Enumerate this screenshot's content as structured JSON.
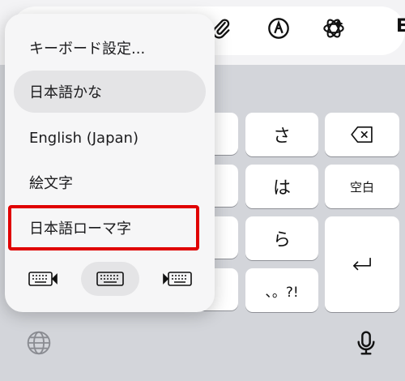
{
  "menu": {
    "items": [
      {
        "label": "キーボード設定..."
      },
      {
        "label": "日本語かな"
      },
      {
        "label": "English (Japan)"
      },
      {
        "label": "絵文字"
      },
      {
        "label": "日本語ローマ字"
      }
    ]
  },
  "keys": {
    "sa": "さ",
    "ha": "は",
    "ra": "ら",
    "punct": "、。?!",
    "space": "空白",
    "delete_icon": "delete-icon",
    "return_icon": "return-icon"
  },
  "toolbar": {
    "icons": [
      "paperclip-icon",
      "pen-circle-icon",
      "sparkle-icon"
    ],
    "cut_text": "E"
  },
  "colors": {
    "highlight_border": "#e00000",
    "keyboard_bg": "#d3d5da",
    "popup_bg": "#f6f6f7"
  }
}
